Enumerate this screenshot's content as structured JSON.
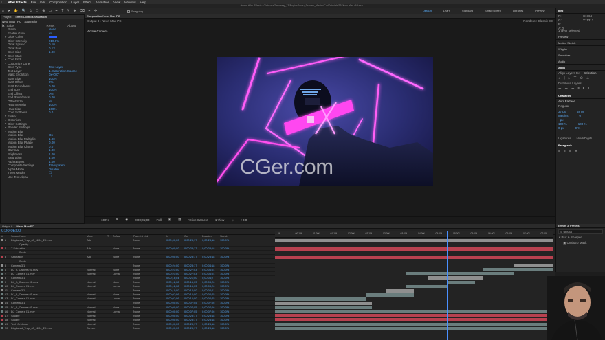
{
  "menubar": {
    "app": "After Effects",
    "items": [
      "File",
      "Edit",
      "Composition",
      "Layer",
      "Effect",
      "Animation",
      "View",
      "Window",
      "Help"
    ]
  },
  "window_title": "Adobe After Effects - /Volumes/Samsung_T5/Engine/Neon_Science_Master/ProfTutorials/03 Neon Man v13.aep *",
  "toolbar": {
    "snapping": "Snapping"
  },
  "workspaces": {
    "items": [
      "Default",
      "Learn",
      "Standard",
      "Small Screen",
      "Libraries",
      "Preview"
    ],
    "active": "Default"
  },
  "effect_controls": {
    "tabs": [
      "Project",
      "Effect Controls Saturation"
    ],
    "subject": "Neon Man PC · Saturation",
    "effect": "Saber",
    "reset": "Reset",
    "about": "About",
    "rows": [
      {
        "label": "Preset",
        "value": "None"
      },
      {
        "label": "Enable Glow",
        "value": "☑"
      },
      {
        "label": "Glow Color",
        "value": ""
      },
      {
        "label": "Glow Intensity",
        "value": "210.0%"
      },
      {
        "label": "Glow Spread",
        "value": "0.10"
      },
      {
        "label": "Glow Bias",
        "value": "0.13"
      },
      {
        "label": "Core Size",
        "value": "1.00"
      },
      {
        "label": "Core Start",
        "value": ""
      },
      {
        "label": "Core End",
        "value": ""
      },
      {
        "label": "Customize Core",
        "value": ""
      },
      {
        "label": "Core Type",
        "value": "Text Layer"
      },
      {
        "label": "Text Layer",
        "value": "1. Saturation  Source"
      },
      {
        "label": "Mask Evolution",
        "value": "0x+0.0°"
      },
      {
        "label": "Start Size",
        "value": "100%"
      },
      {
        "label": "Start Offset",
        "value": "0%"
      },
      {
        "label": "Start Roundness",
        "value": "0.00"
      },
      {
        "label": "End Size",
        "value": "100%"
      },
      {
        "label": "End Offset",
        "value": "0%"
      },
      {
        "label": "End Roundness",
        "value": "0.00"
      },
      {
        "label": "Offset Size",
        "value": "☑"
      },
      {
        "label": "Halo Intensity",
        "value": "100%"
      },
      {
        "label": "Halo Size",
        "value": "100%"
      },
      {
        "label": "Core Softness",
        "value": "0.0"
      },
      {
        "label": "Flicker",
        "value": ""
      },
      {
        "label": "Distortion",
        "value": ""
      },
      {
        "label": "Glow Settings",
        "value": ""
      },
      {
        "label": "Render Settings",
        "value": ""
      },
      {
        "label": "Motion Blur",
        "value": ""
      },
      {
        "label": "Motion Blur",
        "value": "On"
      },
      {
        "label": "Motion Blur Multiplier",
        "value": "1.00"
      },
      {
        "label": "Motion Blur Phase",
        "value": "0.00"
      },
      {
        "label": "Motion Blur Clamp",
        "value": "0.0"
      },
      {
        "label": "Gamma",
        "value": "1.00"
      },
      {
        "label": "Brightness",
        "value": "1.00"
      },
      {
        "label": "Saturation",
        "value": "1.00"
      },
      {
        "label": "Alpha Boost",
        "value": "1.00"
      },
      {
        "label": "Composite Settings",
        "value": "Transparent"
      },
      {
        "label": "Alpha Mode",
        "value": "Disable"
      },
      {
        "label": "Invert Masks",
        "value": "☐"
      },
      {
        "label": "Use Text Alpha",
        "value": "☐"
      }
    ]
  },
  "viewer": {
    "tabs": [
      "Composition Neon Man PC"
    ],
    "breadcrumb": "Output 8 › Neon Man PC",
    "active_camera": "Active Camera",
    "renderer": "Renderer: Classic 3D",
    "footer": {
      "zoom": "100%",
      "timecode": "0;00;05;00",
      "res": "Full",
      "camera": "Active Camera",
      "views": "1 View",
      "offset": "+0.0"
    }
  },
  "watermark": "CGer.com",
  "timeline": {
    "tabs": [
      "Output 8",
      "Neon Man PC"
    ],
    "current_time": "0:00:05:00",
    "columns": [
      "#",
      "Source Name",
      "Mode",
      "T",
      "TrkMat",
      "Parent & Link",
      "In",
      "Out",
      "Duration",
      "Stretch"
    ],
    "layers": [
      {
        "n": "1",
        "name": "Displaced_Trap_48_1204_2K.mov",
        "mode": "Add",
        "trk": "",
        "parent": "None",
        "in": "0;00;00;00",
        "out": "0;00;28;17",
        "dur": "0;00;28;18",
        "str": "100.0%",
        "color": "#8f8f8f",
        "bar": [
          0,
          100
        ]
      },
      {
        "n": "",
        "name": "Opacity",
        "mode": "",
        "trk": "",
        "parent": "",
        "in": "",
        "out": "",
        "dur": "",
        "str": "",
        "color": "",
        "bar": null
      },
      {
        "n": "2",
        "name": "T Saturation",
        "mode": "Add",
        "trk": "None",
        "parent": "None",
        "in": "0;00;00;00",
        "out": "0;00;28;17",
        "dur": "0;00;28;18",
        "str": "100.0%",
        "color": "#b7414f",
        "bar": [
          0,
          100
        ]
      },
      {
        "n": "",
        "name": "Scale",
        "mode": "",
        "trk": "",
        "parent": "",
        "in": "",
        "out": "",
        "dur": "",
        "str": "",
        "color": "",
        "bar": null
      },
      {
        "n": "3",
        "name": "Saturation",
        "mode": "Add",
        "trk": "None",
        "parent": "None",
        "in": "0;00;00;00",
        "out": "0;00;28;17",
        "dur": "0;00;28;18",
        "str": "100.0%",
        "color": "#b7414f",
        "bar": [
          0,
          100
        ]
      },
      {
        "n": "",
        "name": "Scale",
        "mode": "",
        "trk": "",
        "parent": "",
        "in": "",
        "out": "",
        "dur": "",
        "str": "",
        "color": "",
        "bar": null
      },
      {
        "n": "5",
        "name": "Camera 3/1",
        "mode": "",
        "trk": "",
        "parent": "None",
        "in": "0;00;24;00",
        "out": "0;00;28;17",
        "dur": "0;00;04;18",
        "str": "100.0%",
        "color": "#8f8f8f",
        "bar": [
          86,
          100
        ]
      },
      {
        "n": "6",
        "name": "DJ_A_Camera 01.mov",
        "mode": "Normal",
        "trk": "None",
        "parent": "None",
        "in": "0;00;21;00",
        "out": "0;00;27;03",
        "dur": "0;00;06;04",
        "str": "100.0%",
        "color": "#6a7d7d",
        "bar": [
          75,
          100
        ]
      },
      {
        "n": "7",
        "name": "DJ_Camera 01.mov",
        "mode": "Normal",
        "trk": "Luma",
        "parent": "None",
        "in": "0;00;21;00",
        "out": "0;00;27;03",
        "dur": "0;00;06;04",
        "str": "100.0%",
        "color": "#6a7d7d",
        "bar": [
          47,
          86
        ]
      },
      {
        "n": "8",
        "name": "Camera 3/1",
        "mode": "",
        "trk": "",
        "parent": "None",
        "in": "0;00;16;04",
        "out": "0;00;21;00",
        "dur": "0;00;04;27",
        "str": "100.0%",
        "color": "#8f8f8f",
        "bar": [
          55,
          75
        ]
      },
      {
        "n": "9",
        "name": "DJ_A_Camera 01.mov",
        "mode": "Normal",
        "trk": "None",
        "parent": "None",
        "in": "0;00;12;08",
        "out": "0;00;16;03",
        "dur": "0;00;03;26",
        "str": "100.0%",
        "color": "#6a7d7d",
        "bar": [
          62,
          72
        ]
      },
      {
        "n": "10",
        "name": "DJ_Camera 01.mov",
        "mode": "Normal",
        "trk": "Luma",
        "parent": "None",
        "in": "0;00;12;08",
        "out": "0;00;16;03",
        "dur": "0;00;03;26",
        "str": "100.0%",
        "color": "#6a7d7d",
        "bar": [
          47,
          62
        ]
      },
      {
        "n": "11",
        "name": "Camera 3/1",
        "mode": "",
        "trk": "",
        "parent": "None",
        "in": "0;00;10;00",
        "out": "0;00;12;00",
        "dur": "0;00;02;01",
        "str": "100.0%",
        "color": "#8f8f8f",
        "bar": [
          40,
          50
        ]
      },
      {
        "n": "12",
        "name": "DJ_A_Camera 01.mov",
        "mode": "Normal",
        "trk": "None",
        "parent": "None",
        "in": "0;00;07;06",
        "out": "0;00;10;00",
        "dur": "0;00;02;25",
        "str": "100.0%",
        "color": "#6a7d7d",
        "bar": [
          33,
          50
        ]
      },
      {
        "n": "13",
        "name": "DJ_Camera 01.mov",
        "mode": "Normal",
        "trk": "Luma",
        "parent": "None",
        "in": "0;00;07;06",
        "out": "0;00;10;00",
        "dur": "0;00;02;25",
        "str": "100.0%",
        "color": "#6a7d7d",
        "bar": [
          0,
          33
        ]
      },
      {
        "n": "14",
        "name": "Camera 3/1",
        "mode": "",
        "trk": "",
        "parent": "None",
        "in": "0;00;00;00",
        "out": "0;00;07;05",
        "dur": "0;00;07;06",
        "str": "100.0%",
        "color": "#8f8f8f",
        "bar": [
          0,
          35
        ]
      },
      {
        "n": "15",
        "name": "DJ_A_Camera 01.mov",
        "mode": "Normal",
        "trk": "None",
        "parent": "None",
        "in": "0;00;00;00",
        "out": "0;00;07;05",
        "dur": "0;00;07;06",
        "str": "100.0%",
        "color": "#6a7d7d",
        "bar": [
          0,
          35
        ]
      },
      {
        "n": "16",
        "name": "DJ_Camera 01.mov",
        "mode": "Normal",
        "trk": "Luma",
        "parent": "None",
        "in": "0;00;00;00",
        "out": "0;00;07;05",
        "dur": "0;00;07;06",
        "str": "100.0%",
        "color": "#6a7d7d",
        "bar": [
          0,
          100
        ]
      },
      {
        "n": "17",
        "name": "Square",
        "mode": "Normal",
        "trk": "",
        "parent": "None",
        "in": "0;00;00;00",
        "out": "0;00;28;17",
        "dur": "0;00;28;18",
        "str": "100.0%",
        "color": "#b7414f",
        "bar": [
          0,
          100
        ]
      },
      {
        "n": "18",
        "name": "Square",
        "mode": "Normal",
        "trk": "",
        "parent": "None",
        "in": "0;00;00;00",
        "out": "0;00;28;17",
        "dur": "0;00;28;18",
        "str": "100.0%",
        "color": "#b7414f",
        "bar": [
          0,
          100
        ]
      },
      {
        "n": "19",
        "name": "Tech Grid.mov",
        "mode": "Normal",
        "trk": "",
        "parent": "None",
        "in": "0;00;00;00",
        "out": "0;00;28;17",
        "dur": "0;00;28;18",
        "str": "100.0%",
        "color": "#6a7d7d",
        "bar": [
          0,
          100
        ]
      },
      {
        "n": "20",
        "name": "Displaced_Trap_48_1204_2K.mov",
        "mode": "Screen",
        "trk": "",
        "parent": "None",
        "in": "0;00;00;00",
        "out": "0;00;28;17",
        "dur": "0;00;28;18",
        "str": "100.0%",
        "color": "#6a7d7d",
        "bar": [
          0,
          100
        ]
      }
    ],
    "ruler": [
      "0f",
      "00:15f",
      "01:00f",
      "01:15f",
      "02:00f",
      "02:15f",
      "03:00f",
      "03:15f",
      "04:00f",
      "04:15f",
      "05:00f",
      "05:15f",
      "06:00f",
      "06:15f",
      "07:00f",
      "07:15f"
    ]
  },
  "right_panel": {
    "info": "Info",
    "info_rows": [
      "R: ",
      "G: ",
      "B: ",
      "A: 0",
      "X: 364",
      "Y: 1312"
    ],
    "selected": "1 layer selected",
    "sections": [
      "Preview",
      "Motion Sketch",
      "Wiggler",
      "Smoother",
      "Audio"
    ],
    "align": "Align",
    "align_to": "Align Layers to:",
    "align_to_value": "Selection",
    "distribute": "Distribute Layers:",
    "character": "Character",
    "font": "Avril Fatface",
    "font_style": "Regular",
    "paragraph": "Paragraph",
    "ligatures": "Ligatures",
    "hindi": "Hindi Digits"
  },
  "effects_presets": {
    "title": "Effects & Presets",
    "search": "unsha",
    "folder": "Blur & Sharpen",
    "item": "Unsharp Mask"
  }
}
